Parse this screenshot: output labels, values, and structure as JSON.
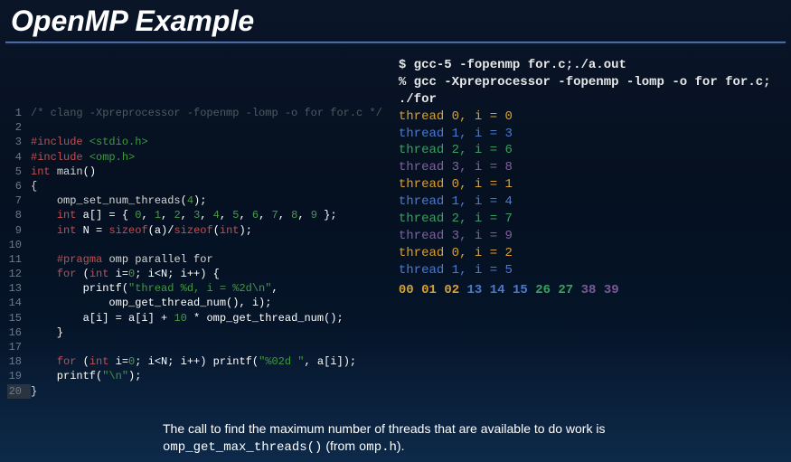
{
  "title": "OpenMP Example",
  "code": {
    "lines": [
      {
        "n": 1,
        "html": "<span class='c-cmt'>/* clang -Xpreprocessor -fopenmp -lomp -o for for.c */</span>"
      },
      {
        "n": 2,
        "html": ""
      },
      {
        "n": 3,
        "html": "<span class='c-pre'>#include</span> <span class='c-str'>&lt;stdio.h&gt;</span>"
      },
      {
        "n": 4,
        "html": "<span class='c-pre'>#include</span> <span class='c-str'>&lt;omp.h&gt;</span>"
      },
      {
        "n": 5,
        "html": "<span class='c-type'>int</span> <span class='c-id'>main</span>()"
      },
      {
        "n": 6,
        "html": "<span class='c-plain'>{</span>"
      },
      {
        "n": 7,
        "html": "    <span class='c-id'>omp_set_num_threads</span>(<span class='c-num'>4</span>);"
      },
      {
        "n": 8,
        "html": "    <span class='c-type'>int</span> a[] = { <span class='c-num'>0</span>, <span class='c-num'>1</span>, <span class='c-num'>2</span>, <span class='c-num'>3</span>, <span class='c-num'>4</span>, <span class='c-num'>5</span>, <span class='c-num'>6</span>, <span class='c-num'>7</span>, <span class='c-num'>8</span>, <span class='c-num'>9</span> };"
      },
      {
        "n": 9,
        "html": "    <span class='c-type'>int</span> N = <span class='c-kw'>sizeof</span>(a)/<span class='c-kw'>sizeof</span>(<span class='c-type'>int</span>);"
      },
      {
        "n": 10,
        "html": ""
      },
      {
        "n": 11,
        "html": "    <span class='c-pre'>#pragma</span> <span class='c-id'>omp parallel for</span>"
      },
      {
        "n": 12,
        "html": "    <span class='c-kw'>for</span> (<span class='c-type'>int</span> i=<span class='c-num'>0</span>; i&lt;N; i++) {"
      },
      {
        "n": 13,
        "html": "        printf(<span class='c-str'>\"thread %d, i = %2d\\n\"</span>,"
      },
      {
        "n": 14,
        "html": "            omp_get_thread_num(), i);"
      },
      {
        "n": 15,
        "html": "        a[i] = a[i] + <span class='c-num'>10</span> * omp_get_thread_num();"
      },
      {
        "n": 16,
        "html": "    }"
      },
      {
        "n": 17,
        "html": ""
      },
      {
        "n": 18,
        "html": "    <span class='c-kw'>for</span> (<span class='c-type'>int</span> i=<span class='c-num'>0</span>; i&lt;N; i++) printf(<span class='c-str'>\"%02d \"</span>, a[i]);"
      },
      {
        "n": 19,
        "html": "    printf(<span class='c-str'>\"\\n\"</span>);"
      },
      {
        "n": 20,
        "html": "<span class='c-plain'>}</span>",
        "hl": true
      }
    ]
  },
  "shell": {
    "cmd1": "$ gcc-5 -fopenmp for.c;./a.out",
    "cmd2": "% gcc -Xpreprocessor -fopenmp -lomp -o for for.c; ./for",
    "output": [
      {
        "cls": "t0",
        "txt": "thread 0, i =  0"
      },
      {
        "cls": "t1",
        "txt": "thread 1, i =  3"
      },
      {
        "cls": "t2",
        "txt": "thread 2, i =  6"
      },
      {
        "cls": "t3",
        "txt": "thread 3, i =  8"
      },
      {
        "cls": "t0",
        "txt": "thread 0, i =  1"
      },
      {
        "cls": "t1",
        "txt": "thread 1, i =  4"
      },
      {
        "cls": "t2",
        "txt": "thread 2, i =  7"
      },
      {
        "cls": "t3",
        "txt": "thread 3, i =  9"
      },
      {
        "cls": "t0",
        "txt": "thread 0, i =  2"
      },
      {
        "cls": "t1",
        "txt": "thread 1, i =  5"
      }
    ],
    "array": [
      {
        "cls": "a0",
        "txt": "00"
      },
      {
        "cls": "a0",
        "txt": "01"
      },
      {
        "cls": "a0",
        "txt": "02"
      },
      {
        "cls": "a1",
        "txt": "13"
      },
      {
        "cls": "a1",
        "txt": "14"
      },
      {
        "cls": "a1",
        "txt": "15"
      },
      {
        "cls": "a2",
        "txt": "26"
      },
      {
        "cls": "a2",
        "txt": "27"
      },
      {
        "cls": "a3",
        "txt": "38"
      },
      {
        "cls": "a3",
        "txt": "39"
      }
    ]
  },
  "footer": {
    "text_before": "The call to find the maximum number of threads that are available to do work is ",
    "code1": "omp_get_max_threads()",
    "text_mid": " (from ",
    "code2": "omp.h",
    "text_after": ")."
  }
}
